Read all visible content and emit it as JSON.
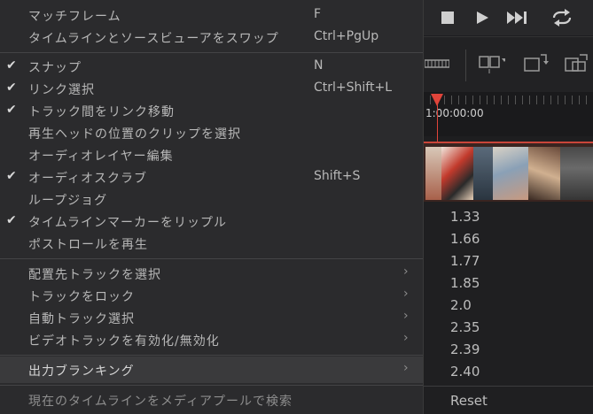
{
  "colors": {
    "menu_bg": "#2b2b2d",
    "highlight": "#3a3a3c",
    "playhead": "#e0443a",
    "text": "#b8b8b8"
  },
  "menu": {
    "items": [
      {
        "label": "マッチフレーム",
        "shortcut": "F",
        "checked": false,
        "submenu": false
      },
      {
        "label": "タイムラインとソースビューアをスワップ",
        "shortcut": "Ctrl+PgUp",
        "checked": false,
        "submenu": false
      },
      {
        "label": "スナップ",
        "shortcut": "N",
        "checked": true,
        "submenu": false
      },
      {
        "label": "リンク選択",
        "shortcut": "Ctrl+Shift+L",
        "checked": true,
        "submenu": false
      },
      {
        "label": "トラック間をリンク移動",
        "shortcut": "",
        "checked": true,
        "submenu": false
      },
      {
        "label": "再生ヘッドの位置のクリップを選択",
        "shortcut": "",
        "checked": false,
        "submenu": false
      },
      {
        "label": "オーディオレイヤー編集",
        "shortcut": "",
        "checked": false,
        "submenu": false
      },
      {
        "label": "オーディオスクラブ",
        "shortcut": "Shift+S",
        "checked": true,
        "submenu": false
      },
      {
        "label": "ループジョグ",
        "shortcut": "",
        "checked": false,
        "submenu": false
      },
      {
        "label": "タイムラインマーカーをリップル",
        "shortcut": "",
        "checked": true,
        "submenu": false
      },
      {
        "label": "ポストロールを再生",
        "shortcut": "",
        "checked": false,
        "submenu": false
      },
      {
        "label": "配置先トラックを選択",
        "shortcut": "",
        "checked": false,
        "submenu": true
      },
      {
        "label": "トラックをロック",
        "shortcut": "",
        "checked": false,
        "submenu": true
      },
      {
        "label": "自動トラック選択",
        "shortcut": "",
        "checked": false,
        "submenu": true
      },
      {
        "label": "ビデオトラックを有効化/無効化",
        "shortcut": "",
        "checked": false,
        "submenu": true
      },
      {
        "label": "出力ブランキング",
        "shortcut": "",
        "checked": false,
        "submenu": true,
        "highlighted": true
      },
      {
        "label": "現在のタイムラインをメディアプールで検索",
        "shortcut": "",
        "checked": false,
        "submenu": false,
        "dim": true
      }
    ],
    "check_glyph": "✔",
    "arrow_glyph": "›"
  },
  "submenu": {
    "items": [
      "1.33",
      "1.66",
      "1.77",
      "1.85",
      "2.0",
      "2.35",
      "2.39",
      "2.40",
      "Reset"
    ]
  },
  "timeline": {
    "timecode": "1:00:00:00"
  },
  "icons": [
    "stop-icon",
    "play-icon",
    "next-clip-icon",
    "loop-icon",
    "trim-tool-icon",
    "dynamic-trim-icon",
    "replace-icon",
    "overwrite-icon"
  ]
}
